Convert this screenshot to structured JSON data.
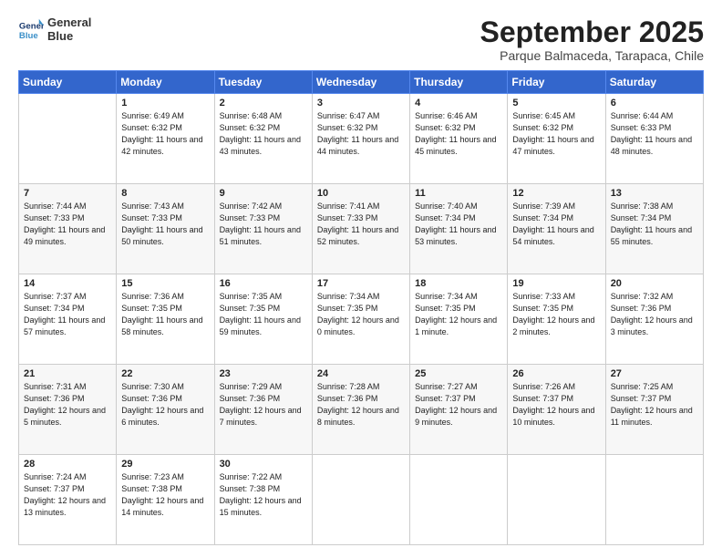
{
  "logo": {
    "line1": "General",
    "line2": "Blue"
  },
  "title": "September 2025",
  "location": "Parque Balmaceda, Tarapaca, Chile",
  "weekdays": [
    "Sunday",
    "Monday",
    "Tuesday",
    "Wednesday",
    "Thursday",
    "Friday",
    "Saturday"
  ],
  "weeks": [
    [
      {
        "day": "",
        "sunrise": "",
        "sunset": "",
        "daylight": ""
      },
      {
        "day": "1",
        "sunrise": "Sunrise: 6:49 AM",
        "sunset": "Sunset: 6:32 PM",
        "daylight": "Daylight: 11 hours and 42 minutes."
      },
      {
        "day": "2",
        "sunrise": "Sunrise: 6:48 AM",
        "sunset": "Sunset: 6:32 PM",
        "daylight": "Daylight: 11 hours and 43 minutes."
      },
      {
        "day": "3",
        "sunrise": "Sunrise: 6:47 AM",
        "sunset": "Sunset: 6:32 PM",
        "daylight": "Daylight: 11 hours and 44 minutes."
      },
      {
        "day": "4",
        "sunrise": "Sunrise: 6:46 AM",
        "sunset": "Sunset: 6:32 PM",
        "daylight": "Daylight: 11 hours and 45 minutes."
      },
      {
        "day": "5",
        "sunrise": "Sunrise: 6:45 AM",
        "sunset": "Sunset: 6:32 PM",
        "daylight": "Daylight: 11 hours and 47 minutes."
      },
      {
        "day": "6",
        "sunrise": "Sunrise: 6:44 AM",
        "sunset": "Sunset: 6:33 PM",
        "daylight": "Daylight: 11 hours and 48 minutes."
      }
    ],
    [
      {
        "day": "7",
        "sunrise": "Sunrise: 7:44 AM",
        "sunset": "Sunset: 7:33 PM",
        "daylight": "Daylight: 11 hours and 49 minutes."
      },
      {
        "day": "8",
        "sunrise": "Sunrise: 7:43 AM",
        "sunset": "Sunset: 7:33 PM",
        "daylight": "Daylight: 11 hours and 50 minutes."
      },
      {
        "day": "9",
        "sunrise": "Sunrise: 7:42 AM",
        "sunset": "Sunset: 7:33 PM",
        "daylight": "Daylight: 11 hours and 51 minutes."
      },
      {
        "day": "10",
        "sunrise": "Sunrise: 7:41 AM",
        "sunset": "Sunset: 7:33 PM",
        "daylight": "Daylight: 11 hours and 52 minutes."
      },
      {
        "day": "11",
        "sunrise": "Sunrise: 7:40 AM",
        "sunset": "Sunset: 7:34 PM",
        "daylight": "Daylight: 11 hours and 53 minutes."
      },
      {
        "day": "12",
        "sunrise": "Sunrise: 7:39 AM",
        "sunset": "Sunset: 7:34 PM",
        "daylight": "Daylight: 11 hours and 54 minutes."
      },
      {
        "day": "13",
        "sunrise": "Sunrise: 7:38 AM",
        "sunset": "Sunset: 7:34 PM",
        "daylight": "Daylight: 11 hours and 55 minutes."
      }
    ],
    [
      {
        "day": "14",
        "sunrise": "Sunrise: 7:37 AM",
        "sunset": "Sunset: 7:34 PM",
        "daylight": "Daylight: 11 hours and 57 minutes."
      },
      {
        "day": "15",
        "sunrise": "Sunrise: 7:36 AM",
        "sunset": "Sunset: 7:35 PM",
        "daylight": "Daylight: 11 hours and 58 minutes."
      },
      {
        "day": "16",
        "sunrise": "Sunrise: 7:35 AM",
        "sunset": "Sunset: 7:35 PM",
        "daylight": "Daylight: 11 hours and 59 minutes."
      },
      {
        "day": "17",
        "sunrise": "Sunrise: 7:34 AM",
        "sunset": "Sunset: 7:35 PM",
        "daylight": "Daylight: 12 hours and 0 minutes."
      },
      {
        "day": "18",
        "sunrise": "Sunrise: 7:34 AM",
        "sunset": "Sunset: 7:35 PM",
        "daylight": "Daylight: 12 hours and 1 minute."
      },
      {
        "day": "19",
        "sunrise": "Sunrise: 7:33 AM",
        "sunset": "Sunset: 7:35 PM",
        "daylight": "Daylight: 12 hours and 2 minutes."
      },
      {
        "day": "20",
        "sunrise": "Sunrise: 7:32 AM",
        "sunset": "Sunset: 7:36 PM",
        "daylight": "Daylight: 12 hours and 3 minutes."
      }
    ],
    [
      {
        "day": "21",
        "sunrise": "Sunrise: 7:31 AM",
        "sunset": "Sunset: 7:36 PM",
        "daylight": "Daylight: 12 hours and 5 minutes."
      },
      {
        "day": "22",
        "sunrise": "Sunrise: 7:30 AM",
        "sunset": "Sunset: 7:36 PM",
        "daylight": "Daylight: 12 hours and 6 minutes."
      },
      {
        "day": "23",
        "sunrise": "Sunrise: 7:29 AM",
        "sunset": "Sunset: 7:36 PM",
        "daylight": "Daylight: 12 hours and 7 minutes."
      },
      {
        "day": "24",
        "sunrise": "Sunrise: 7:28 AM",
        "sunset": "Sunset: 7:36 PM",
        "daylight": "Daylight: 12 hours and 8 minutes."
      },
      {
        "day": "25",
        "sunrise": "Sunrise: 7:27 AM",
        "sunset": "Sunset: 7:37 PM",
        "daylight": "Daylight: 12 hours and 9 minutes."
      },
      {
        "day": "26",
        "sunrise": "Sunrise: 7:26 AM",
        "sunset": "Sunset: 7:37 PM",
        "daylight": "Daylight: 12 hours and 10 minutes."
      },
      {
        "day": "27",
        "sunrise": "Sunrise: 7:25 AM",
        "sunset": "Sunset: 7:37 PM",
        "daylight": "Daylight: 12 hours and 11 minutes."
      }
    ],
    [
      {
        "day": "28",
        "sunrise": "Sunrise: 7:24 AM",
        "sunset": "Sunset: 7:37 PM",
        "daylight": "Daylight: 12 hours and 13 minutes."
      },
      {
        "day": "29",
        "sunrise": "Sunrise: 7:23 AM",
        "sunset": "Sunset: 7:38 PM",
        "daylight": "Daylight: 12 hours and 14 minutes."
      },
      {
        "day": "30",
        "sunrise": "Sunrise: 7:22 AM",
        "sunset": "Sunset: 7:38 PM",
        "daylight": "Daylight: 12 hours and 15 minutes."
      },
      {
        "day": "",
        "sunrise": "",
        "sunset": "",
        "daylight": ""
      },
      {
        "day": "",
        "sunrise": "",
        "sunset": "",
        "daylight": ""
      },
      {
        "day": "",
        "sunrise": "",
        "sunset": "",
        "daylight": ""
      },
      {
        "day": "",
        "sunrise": "",
        "sunset": "",
        "daylight": ""
      }
    ]
  ]
}
